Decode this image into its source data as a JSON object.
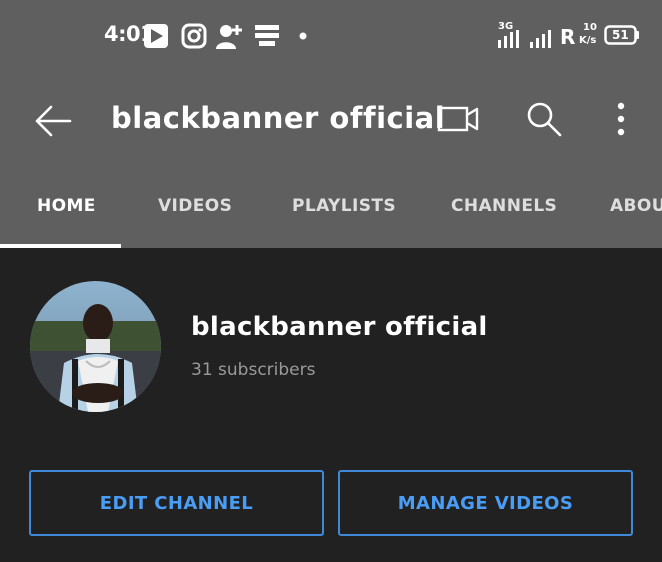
{
  "status_bar": {
    "time": "4:01",
    "network_type": "3G",
    "roaming": "R",
    "speed_value": "10",
    "speed_unit": "K/s",
    "battery": "51",
    "notification_icons": [
      "play-store-icon",
      "instagram-icon",
      "add-person-icon",
      "message-icon",
      "dot-icon"
    ]
  },
  "app_bar": {
    "title": "blackbanner official",
    "actions": [
      "upload-video-icon",
      "search-icon",
      "more-options-icon"
    ]
  },
  "tabs": [
    {
      "label": "HOME",
      "active": true
    },
    {
      "label": "VIDEOS",
      "active": false
    },
    {
      "label": "PLAYLISTS",
      "active": false
    },
    {
      "label": "CHANNELS",
      "active": false
    },
    {
      "label": "ABOUT",
      "active": false
    }
  ],
  "channel": {
    "name": "blackbanner official",
    "subscribers": "31 subscribers"
  },
  "buttons": {
    "edit_channel": "EDIT CHANNEL",
    "manage_videos": "MANAGE VIDEOS"
  },
  "colors": {
    "header_bg": "#5f5f5f",
    "page_bg": "#212121",
    "accent": "#3e8ad8"
  }
}
